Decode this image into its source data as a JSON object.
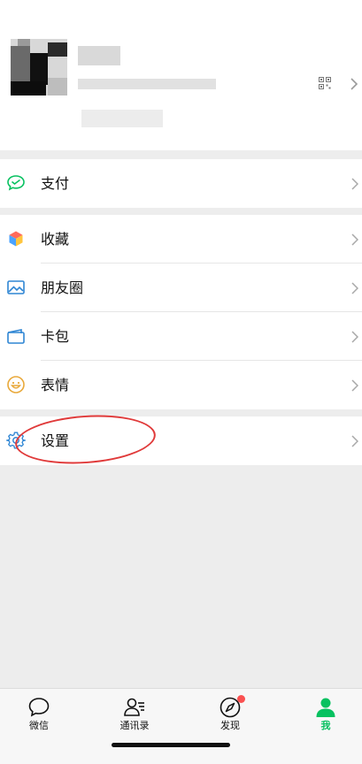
{
  "menu": {
    "pay_label": "支付",
    "favorites_label": "收藏",
    "moments_label": "朋友圈",
    "cards_label": "卡包",
    "stickers_label": "表情",
    "settings_label": "设置"
  },
  "tabbar": {
    "chats_label": "微信",
    "contacts_label": "通讯录",
    "discover_label": "发现",
    "me_label": "我"
  },
  "colors": {
    "accent": "#07c160",
    "badge": "#fa5151",
    "annotation_ring": "#e03a3a",
    "background": "#ededed"
  },
  "icons": {
    "header": [
      "qr-code-icon",
      "chevron-right-icon"
    ],
    "menu": [
      "wechat-pay-icon",
      "favorites-cube-icon",
      "moments-album-icon",
      "card-wallet-icon",
      "sticker-smiley-icon",
      "settings-gear-icon"
    ],
    "tabs": [
      "chat-bubble-icon",
      "contacts-person-icon",
      "compass-icon",
      "person-filled-icon"
    ]
  }
}
